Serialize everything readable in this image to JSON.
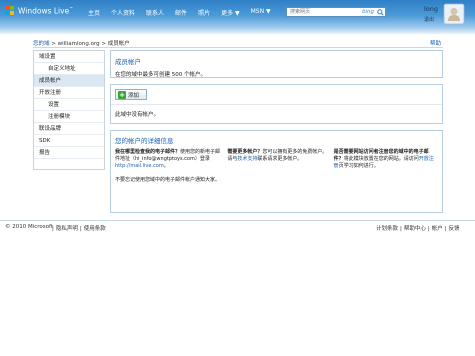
{
  "header": {
    "brand": "Windows Live",
    "brand_mark": "™",
    "nav": [
      "主页",
      "个人资料",
      "联系人",
      "邮件",
      "照片",
      "更多 ▼",
      "MSN ▼"
    ],
    "search": {
      "placeholder": "搜索网页",
      "brand": "bing"
    },
    "user": {
      "name": "long",
      "signout": "退出"
    }
  },
  "breadcrumb": {
    "home": "您的域",
    "trail": " > williamlong.org > 成员帐户"
  },
  "help": "帮助",
  "sidebar": {
    "items": [
      {
        "label": "域设置",
        "sub": false,
        "active": false
      },
      {
        "label": "自定义地址",
        "sub": true,
        "active": false
      },
      {
        "label": "成员帐户",
        "sub": false,
        "active": true
      },
      {
        "label": "开放注册",
        "sub": false,
        "active": false
      },
      {
        "label": "设置",
        "sub": true,
        "active": false
      },
      {
        "label": "注册模块",
        "sub": true,
        "active": false
      },
      {
        "label": "联设品牌",
        "sub": false,
        "active": false
      },
      {
        "label": "SDK",
        "sub": false,
        "active": false
      },
      {
        "label": "报告",
        "sub": false,
        "active": false
      }
    ]
  },
  "accounts_panel": {
    "title": "成员帐户",
    "desc": "在您的域中最多可创建 500 个帐户。"
  },
  "add_panel": {
    "add_label": "添加",
    "empty_text": "此域中没有帐户。"
  },
  "info_panel": {
    "title": "您的帐户的详细信息",
    "col1": {
      "bold": "我在哪里检查我的电子邮件？",
      "text": "使用您的新电子邮件地址（hi_info@wngtptoys.com）登录",
      "link": "http://mail.live.com",
      "text_end": "。",
      "para2": "不要忘记使用您域中的电子邮件帐户通知大家。"
    },
    "col2": {
      "bold": "需要更多帐户？",
      "text": "您可以拥有更多的免费帐户。请与",
      "link": "技术支持",
      "text_end": "联系请求更多帐户。"
    },
    "col3": {
      "bold": "是否需要网站访问者注册您的域中的电子邮件？",
      "text": "将此模块放置在您的网站。请访问",
      "link": "开放注册",
      "text_end": "页学习如何进行。"
    }
  },
  "footer": {
    "copyright": "© 2010 Microsoft",
    "links": [
      "隐私声明",
      "使用条款"
    ],
    "right_links": [
      "计划条款",
      "帮助中心",
      "帐户",
      "反馈"
    ]
  },
  "colors": {
    "header_blue": "#2f7fc6",
    "link": "#1a5fb4",
    "active_row": "#dbe7f3"
  }
}
